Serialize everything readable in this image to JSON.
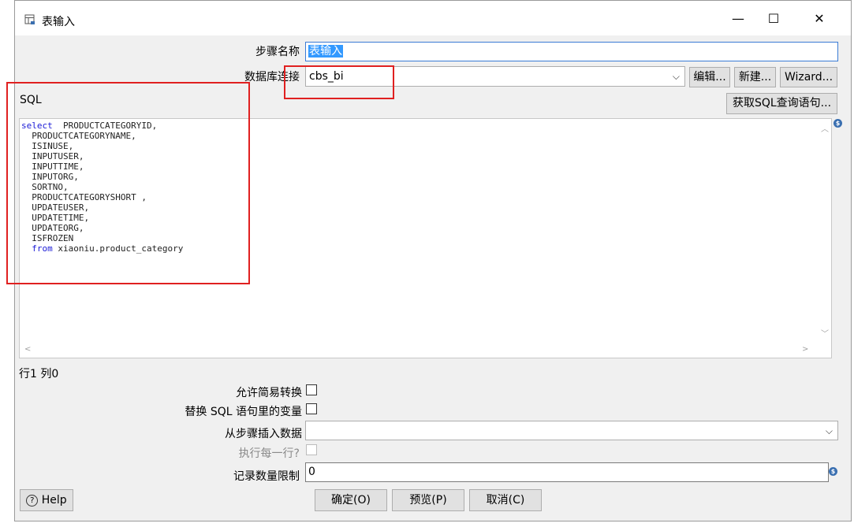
{
  "window": {
    "title": "表输入",
    "minimize_glyph": "—",
    "maximize_glyph": "☐",
    "close_glyph": "✕"
  },
  "form": {
    "step_name_label": "步骤名称",
    "step_name_value": "表输入",
    "db_conn_label": "数据库连接",
    "db_conn_value": "cbs_bi",
    "edit_btn": "编辑...",
    "new_btn": "新建...",
    "wizard_btn": "Wizard...",
    "sql_label": "SQL",
    "get_sql_btn": "获取SQL查询语句..."
  },
  "sql": {
    "lines": [
      {
        "kw": "select",
        "text": "  PRODUCTCATEGORYID,"
      },
      {
        "kw": "",
        "text": "  PRODUCTCATEGORYNAME,"
      },
      {
        "kw": "",
        "text": "  ISINUSE,"
      },
      {
        "kw": "",
        "text": "  INPUTUSER,"
      },
      {
        "kw": "",
        "text": "  INPUTTIME,"
      },
      {
        "kw": "",
        "text": "  INPUTORG,"
      },
      {
        "kw": "",
        "text": "  SORTNO,"
      },
      {
        "kw": "",
        "text": "  PRODUCTCATEGORYSHORT ,"
      },
      {
        "kw": "",
        "text": "  UPDATEUSER,"
      },
      {
        "kw": "",
        "text": "  UPDATETIME,"
      },
      {
        "kw": "",
        "text": "  UPDATEORG,"
      },
      {
        "kw": "",
        "text": "  ISFROZEN"
      },
      {
        "kw": "  from",
        "text": " xiaoniu.product_category"
      }
    ],
    "position": "行1 列0"
  },
  "options": {
    "lazy_conversion_label": "允许简易转换",
    "replace_vars_label": "替换 SQL 语句里的变量",
    "insert_from_step_label": "从步骤插入数据",
    "insert_from_step_value": "",
    "execute_each_row_label": "执行每一行?",
    "limit_label": "记录数量限制",
    "limit_value": "0"
  },
  "footer": {
    "help_btn": "Help",
    "ok_btn": "确定(O)",
    "preview_btn": "预览(P)",
    "cancel_btn": "取消(C)"
  },
  "icons": {
    "variable": "$",
    "help": "?",
    "dropdown": "⌵"
  },
  "colors": {
    "annotation_box": "#e02020",
    "selection": "#3399ff",
    "sql_keyword": "#1a1ad6"
  }
}
